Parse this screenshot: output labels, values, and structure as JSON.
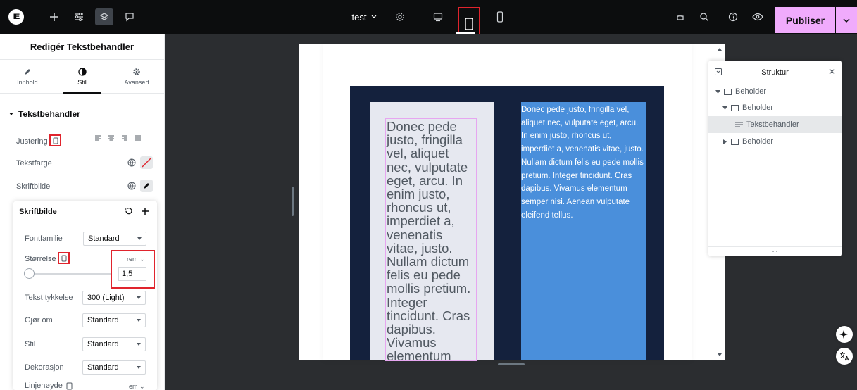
{
  "topbar": {
    "logo_text": "IE",
    "doc_name": "test",
    "publish_label": "Publiser"
  },
  "panel": {
    "title": "Redigér Tekstbehandler",
    "tabs": [
      {
        "label": "Innhold",
        "icon": "pencil-icon"
      },
      {
        "label": "Stil",
        "icon": "half-circle-icon"
      },
      {
        "label": "Avansert",
        "icon": "gear-icon"
      }
    ],
    "section": "Tekstbehandler",
    "controls": {
      "alignment": "Justering",
      "text_color": "Tekstfarge",
      "typography": "Skriftbilde"
    }
  },
  "typography_popover": {
    "title": "Skriftbilde",
    "font_family_label": "Fontfamilie",
    "font_family_value": "Standard",
    "size_label": "Størrelse",
    "size_unit": "rem",
    "size_value": "1,5",
    "weight_label": "Tekst tykkelse",
    "weight_value": "300 (Light)",
    "transform_label": "Gjør om",
    "transform_value": "Standard",
    "style_label": "Stil",
    "style_value": "Standard",
    "decoration_label": "Dekorasjon",
    "decoration_value": "Standard",
    "line_height_label": "Linjehøyde",
    "line_height_unit": "em"
  },
  "canvas": {
    "text_left": "Donec pede justo, fringilla vel, aliquet nec, vulputate eget, arcu. In enim justo, rhoncus ut, imperdiet a, venenatis vitae, justo. Nullam dictum felis eu pede mollis pretium. Integer tincidunt. Cras dapibus. Vivamus elementum semper nisi.",
    "text_right": "Donec pede justo, fringilla vel, aliquet nec, vulputate eget, arcu. In enim justo, rhoncus ut, imperdiet a, venenatis vitae, justo. Nullam dictum felis eu pede mollis pretium. Integer tincidunt. Cras dapibus. Vivamus elementum semper nisi. Aenean vulputate eleifend tellus."
  },
  "structure": {
    "title": "Struktur",
    "items": [
      {
        "label": "Beholder"
      },
      {
        "label": "Beholder"
      },
      {
        "label": "Tekstbehandler"
      },
      {
        "label": "Beholder"
      }
    ],
    "footer": "..."
  },
  "colors": {
    "publish_bg": "#f0abfc",
    "highlight_red": "#e0242d",
    "container_navy": "#14213d",
    "column_blue": "#4a8fdb"
  }
}
